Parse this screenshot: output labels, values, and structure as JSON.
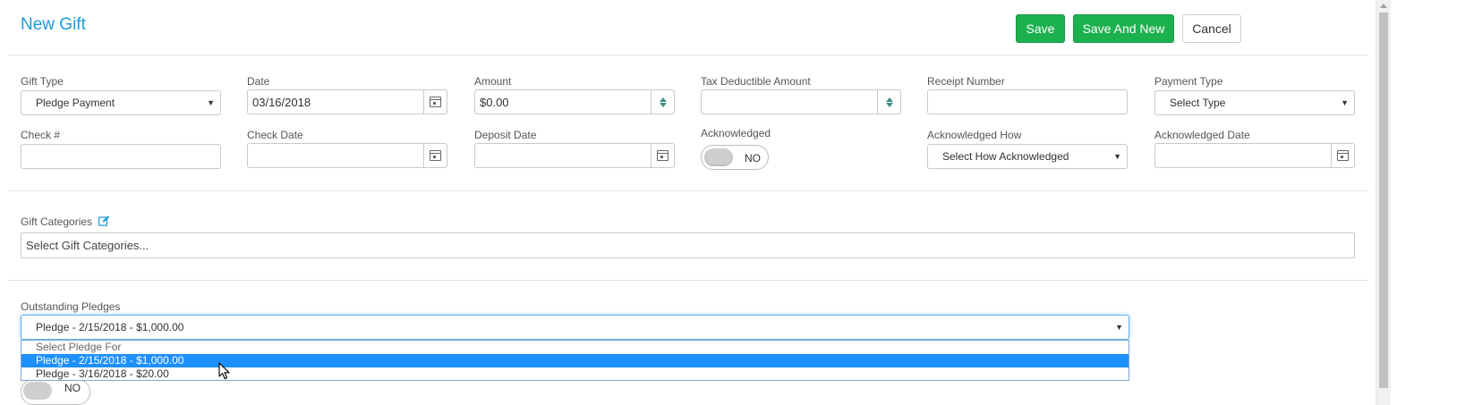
{
  "page": {
    "title": "New Gift"
  },
  "toolbar": {
    "save_label": "Save",
    "save_and_new_label": "Save And New",
    "cancel_label": "Cancel"
  },
  "form": {
    "gift_type": {
      "label": "Gift Type",
      "value": "Pledge Payment"
    },
    "date": {
      "label": "Date",
      "value": "03/16/2018"
    },
    "amount": {
      "label": "Amount",
      "value": "$0.00"
    },
    "tax_deductible_amount": {
      "label": "Tax Deductible Amount",
      "value": ""
    },
    "receipt_number": {
      "label": "Receipt Number",
      "value": ""
    },
    "payment_type": {
      "label": "Payment Type",
      "value": "Select Type"
    },
    "check_number": {
      "label": "Check #",
      "value": ""
    },
    "check_date": {
      "label": "Check Date",
      "value": ""
    },
    "deposit_date": {
      "label": "Deposit Date",
      "value": ""
    },
    "acknowledged": {
      "label": "Acknowledged",
      "toggle_text": "NO"
    },
    "acknowledged_how": {
      "label": "Acknowledged How",
      "value": "Select How Acknowledged"
    },
    "acknowledged_date": {
      "label": "Acknowledged Date",
      "value": ""
    }
  },
  "gift_categories": {
    "label": "Gift Categories",
    "placeholder": "Select Gift Categories..."
  },
  "outstanding_pledges": {
    "label": "Outstanding Pledges",
    "selected": "Pledge - 2/15/2018 - $1,000.00",
    "options": [
      "Select Pledge For",
      "Pledge - 2/15/2018 - $1,000.00",
      "Pledge - 3/16/2018 - $20.00"
    ],
    "highlighted_index": 1
  },
  "hidden_toggle": {
    "text": "NO"
  },
  "colors": {
    "title_blue": "#1a9bd7",
    "button_green": "#1cb14f",
    "highlight_blue": "#1e90ff",
    "spinner_teal": "#3f8f88"
  },
  "icons": {
    "calendar": "calendar-icon",
    "spinner": "spinner-icon",
    "edit": "edit-icon",
    "caret": "caret-down-icon",
    "cursor": "mouse-cursor-icon"
  }
}
